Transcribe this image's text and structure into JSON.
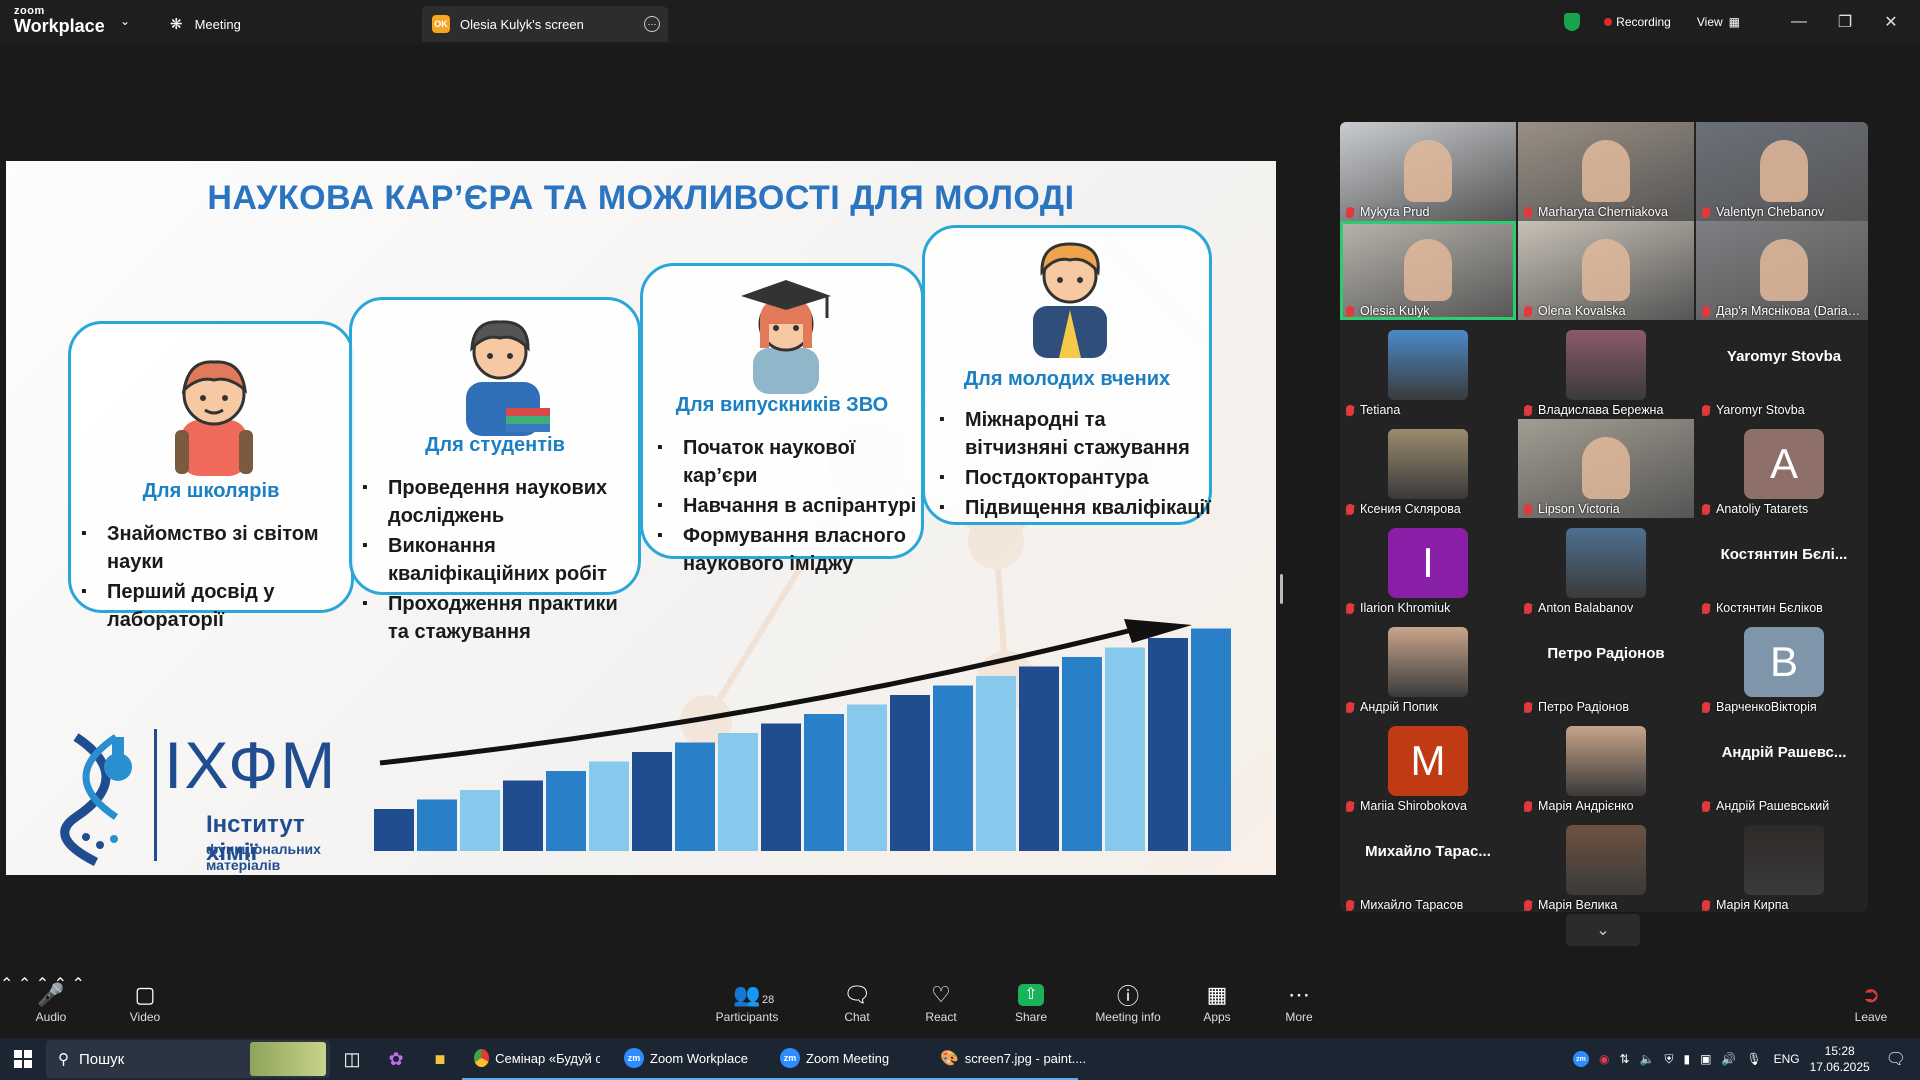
{
  "app": {
    "logo_top": "zoom",
    "logo_bottom": "Workplace"
  },
  "tabs": [
    {
      "label": "Meeting"
    },
    {
      "label": "Olesia Kulyk's screen",
      "badge": "OK"
    }
  ],
  "titlebar": {
    "recording": "Recording",
    "view": "View"
  },
  "slide": {
    "title": "НАУКОВА КАР’ЄРА ТА МОЖЛИВОСТІ ДЛЯ МОЛОДІ",
    "cards": [
      {
        "heading": "Для школярів",
        "items": [
          "Знайомство зі світом науки",
          "Перший досвід у лабораторії"
        ]
      },
      {
        "heading": "Для студентів",
        "items": [
          "Проведення наукових досліджень",
          "Виконання кваліфікаційних робіт",
          "Проходження практики та стажування"
        ]
      },
      {
        "heading": "Для випускників ЗВО",
        "items": [
          "Початок наукової кар’єри",
          "Навчання в аспірантурі",
          "Формування власного наукового іміджу"
        ]
      },
      {
        "heading": "Для молодих вчених",
        "items": [
          "Міжнародні та вітчизняні стажування",
          "Постдокторантура",
          "Підвищення кваліфікації"
        ]
      }
    ],
    "logo": {
      "abbr": "ІХФМ",
      "line1": "Інститут хімії",
      "line2": "функціональних матеріалів"
    }
  },
  "participants": [
    {
      "name": "Mykyta Prud",
      "type": "video",
      "bg": "#c9ccd0"
    },
    {
      "name": "Marharyta Cherniakova",
      "type": "video",
      "bg": "#9a8f83"
    },
    {
      "name": "Valentyn Chebanov",
      "type": "video",
      "bg": "#6b7078"
    },
    {
      "name": "Olesia Kulyk",
      "type": "video",
      "bg": "#b8b4ac",
      "active": true
    },
    {
      "name": "Olena Kovalska",
      "type": "video",
      "bg": "#c7c0b5"
    },
    {
      "name": "Дар'я Мяснікова (Daria…",
      "type": "video",
      "bg": "#7d7f82"
    },
    {
      "name": "Tetiana",
      "type": "thumb",
      "bg": "#4a8ac7"
    },
    {
      "name": "Владислава Бережна",
      "type": "thumb",
      "bg": "#8b5a6a"
    },
    {
      "name": "Yaromyr Stovba",
      "type": "text",
      "big": "Yaromyr Stovba"
    },
    {
      "name": "Ксения Склярова",
      "type": "thumb",
      "bg": "#9b8a6e"
    },
    {
      "name": "Lipson Victoria",
      "type": "video",
      "bg": "#a39d92"
    },
    {
      "name": "Anatoliy Tatarets",
      "type": "avatar",
      "letter": "A",
      "bg": "#8e6f6a"
    },
    {
      "name": "Ilarion Khromiuk",
      "type": "avatar",
      "letter": "I",
      "bg": "#8a1fa8"
    },
    {
      "name": "Anton Balabanov",
      "type": "thumb",
      "bg": "#4f6f8f"
    },
    {
      "name": "Костянтин Бєліков",
      "type": "text",
      "big": "Костянтин Бєлі..."
    },
    {
      "name": "Андрій Попик",
      "type": "thumb",
      "bg": "#c9a58c"
    },
    {
      "name": "Петро Радіонов",
      "type": "text",
      "big": "Петро Радіонов"
    },
    {
      "name": "ВарченкоВікторія",
      "type": "avatar",
      "letter": "B",
      "bg": "#7f96aa"
    },
    {
      "name": "Mariia Shirobokova",
      "type": "avatar",
      "letter": "M",
      "bg": "#c03a14"
    },
    {
      "name": "Марія Андрієнко",
      "type": "thumb",
      "bg": "#c7a48a"
    },
    {
      "name": "Андрій Рашевський",
      "type": "text",
      "big": "Андрій Рашевс..."
    },
    {
      "name": "Михайло Тарасов",
      "type": "text",
      "big": "Михайло Тарас..."
    },
    {
      "name": "Марія Велика",
      "type": "thumb",
      "bg": "#6e5240"
    },
    {
      "name": "Марія Кирпа",
      "type": "thumb",
      "bg": "#2e2a28"
    }
  ],
  "controls": {
    "audio": "Audio",
    "video": "Video",
    "participants": "Participants",
    "participants_count": "28",
    "chat": "Chat",
    "react": "React",
    "share": "Share",
    "info": "Meeting info",
    "apps": "Apps",
    "more": "More",
    "leave": "Leave"
  },
  "taskbar": {
    "search": "Пошук",
    "apps": [
      "Семінар «Будуй св...",
      "Zoom Workplace",
      "Zoom Meeting",
      "screen7.jpg - paint...."
    ],
    "lang": "ENG",
    "time": "15:28",
    "date": "17.06.2025"
  },
  "colors": {
    "accent_green": "#19b35a",
    "slide_blue": "#2a74c0",
    "card_border": "#2aa7d9",
    "mic_muted": "#e0393e"
  }
}
